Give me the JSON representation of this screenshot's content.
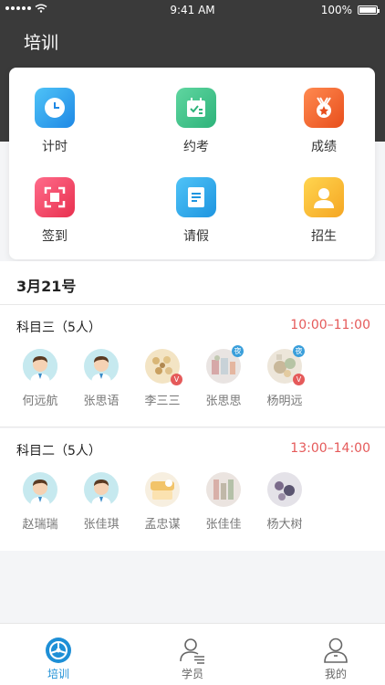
{
  "status_bar": {
    "time": "9:41 AM",
    "battery": "100%"
  },
  "page": {
    "title": "培训"
  },
  "menu": [
    {
      "label": "计时",
      "icon": "clock-icon",
      "color": "#2f9ee6"
    },
    {
      "label": "约考",
      "icon": "calendar-icon",
      "color": "#3cc08a"
    },
    {
      "label": "成绩",
      "icon": "medal-icon",
      "color": "#f06a34"
    },
    {
      "label": "签到",
      "icon": "scan-icon",
      "color": "#f0456a"
    },
    {
      "label": "请假",
      "icon": "document-icon",
      "color": "#2aa6ea"
    },
    {
      "label": "招生",
      "icon": "person-icon",
      "color": "#f5b324"
    }
  ],
  "schedule": {
    "date": "3月21号",
    "courses": [
      {
        "title": "科目三（5人）",
        "time": "10:00–11:00",
        "students": [
          {
            "name": "何远航"
          },
          {
            "name": "张思语"
          },
          {
            "name": "李三三",
            "badge": "V"
          },
          {
            "name": "张思思",
            "badge": "夜"
          },
          {
            "name": "杨明远",
            "badge": "V",
            "badge2": "夜"
          }
        ]
      },
      {
        "title": "科目二（5人）",
        "time": "13:00–14:00",
        "students": [
          {
            "name": "赵瑞瑞"
          },
          {
            "name": "张佳琪"
          },
          {
            "name": "孟忠谋"
          },
          {
            "name": "张佳佳"
          },
          {
            "name": "杨大树"
          }
        ]
      }
    ]
  },
  "tabbar": [
    {
      "label": "培训",
      "icon": "steering-wheel-icon",
      "active": true
    },
    {
      "label": "学员",
      "icon": "students-icon",
      "active": false
    },
    {
      "label": "我的",
      "icon": "profile-icon",
      "active": false
    }
  ],
  "colors": {
    "accent": "#1e8fd6",
    "time_red": "#e55a5a",
    "header": "#3a3a3a"
  }
}
